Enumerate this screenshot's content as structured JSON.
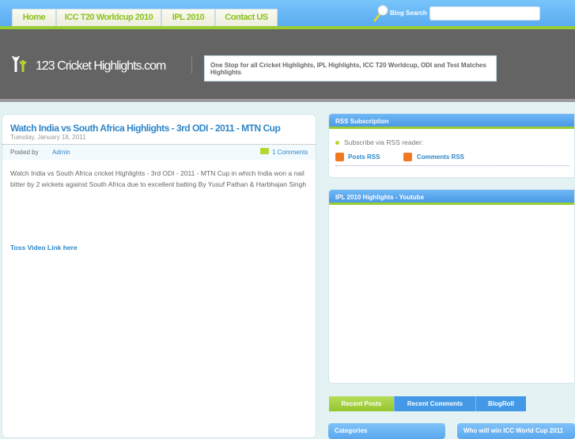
{
  "nav": {
    "items": [
      "Home",
      "ICC T20 Worldcup 2010",
      "IPL 2010",
      "Contact US"
    ]
  },
  "search": {
    "label": "Blog Search",
    "value": ""
  },
  "header": {
    "logo": "123 Cricket Highlights.com",
    "tagline": "One Stop for all Cricket Highlights, IPL Highlights, ICC T20 Worldcup, ODI and Test Matches Highlights"
  },
  "post": {
    "title": "Watch India vs South Africa Highlights - 3rd ODI - 2011 - MTN Cup",
    "date": "Tuesday, January 18, 2011",
    "posted_by": "Posted by",
    "author": "Admin",
    "comments": "1 Comments",
    "body": "Watch India vs South Africa cricket Highlights - 3rd ODI - 2011 - MTN Cup in which India won a nail bitter by 2 wickets against South Africa due to excellent batting By Yusuf Pathan & Harbhajan Singh",
    "link": "Toss Video Link here"
  },
  "sidebar": {
    "rss_title": "RSS Subscription",
    "rss_text": "Subscribe via RSS reader:",
    "posts_rss": "Posts RSS",
    "comments_rss": "Comments RSS",
    "ipl_title": "IPL 2010 Highlights - Youtube",
    "tabs": [
      "Recent Posts",
      "Recent Comments",
      "BlogRoll"
    ],
    "categories": "Categories",
    "poll": "Who will win ICC World Cup 2011"
  },
  "colors": {
    "accent_green": "#99cc33",
    "link_blue": "#2f86c8"
  }
}
